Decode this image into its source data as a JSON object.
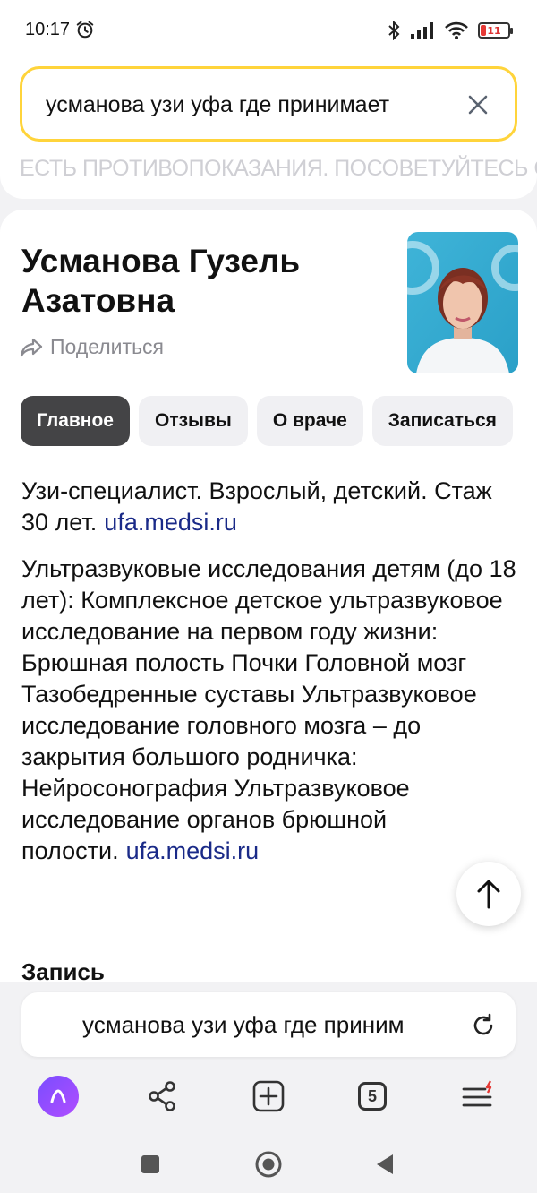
{
  "status_bar": {
    "time": "10:17",
    "battery_level": "11"
  },
  "search": {
    "query": "усманова узи уфа где принимает"
  },
  "banner": {
    "text": "ЕСТЬ ПРОТИВОПОКАЗАНИЯ. ПОСОВЕТУЙТЕСЬ С ВРАЧОМ"
  },
  "doctor": {
    "name": "Усманова Гузель Азатовна",
    "share_label": "Поделиться"
  },
  "tabs": [
    {
      "label": "Главное",
      "active": true
    },
    {
      "label": "Отзывы",
      "active": false
    },
    {
      "label": "О враче",
      "active": false
    },
    {
      "label": "Записаться",
      "active": false
    }
  ],
  "summary": {
    "text": "Узи-специалист. Взрослый, детский. Стаж 30 лет.",
    "link": "ufa.medsi.ru"
  },
  "description": {
    "text": "Ультразвуковые исследования детям (до 18 лет): Комплексное детское ультразвуковое исследование на первом году жизни: Брюшная полость Почки Головной мозг Тазобедренные суставы Ультразвуковое исследование головного мозга – до закрытия большого родничка: Нейросонография Ультразвуковое исследование органов брюшной полости.",
    "link": "ufa.medsi.ru"
  },
  "section": {
    "title": "Запись"
  },
  "address_bar": {
    "text": "усманова узи уфа где приним"
  },
  "toolbar": {
    "tabs_count": "5"
  },
  "colors": {
    "search_border": "#ffd43b",
    "link": "#1a2a88",
    "active_tab": "#444446",
    "alice": "#8a4dff"
  }
}
